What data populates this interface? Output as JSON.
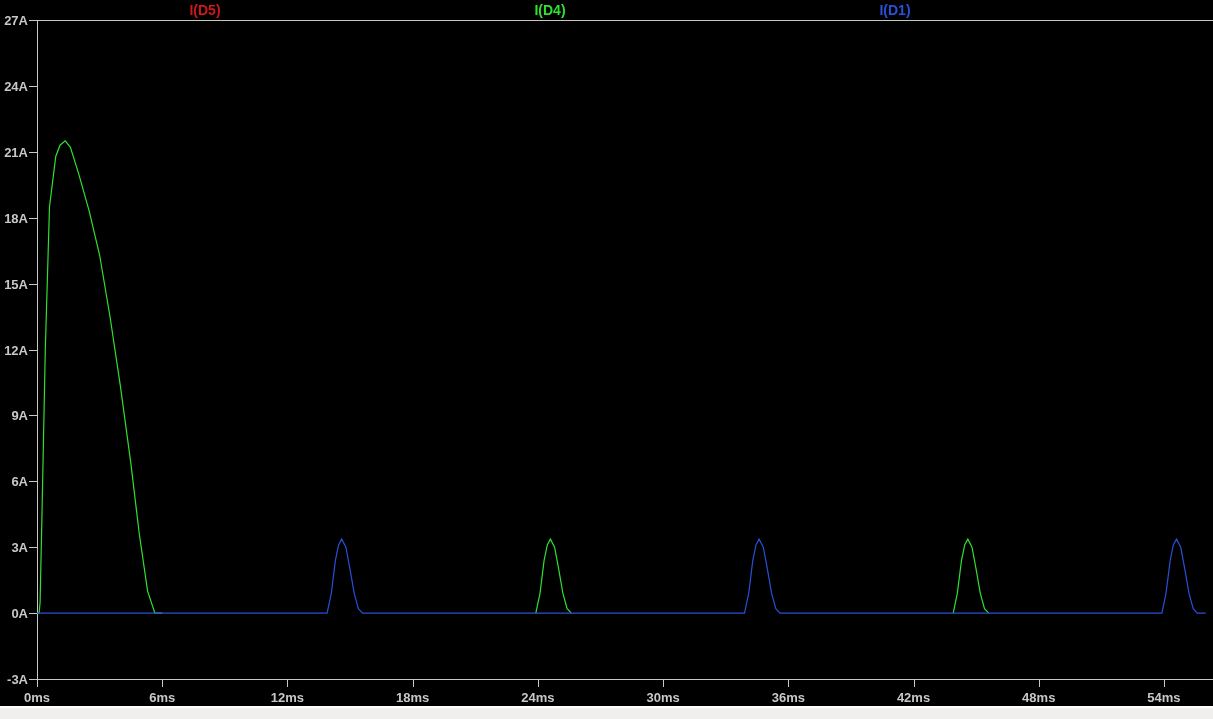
{
  "plot": {
    "chart_data": {
      "type": "line",
      "xlim": [
        0,
        56.35
      ],
      "ylim": [
        -3,
        27
      ],
      "xticks": [
        {
          "value": 0,
          "label": "0ms"
        },
        {
          "value": 6,
          "label": "6ms"
        },
        {
          "value": 12,
          "label": "12ms"
        },
        {
          "value": 18,
          "label": "18ms"
        },
        {
          "value": 24,
          "label": "24ms"
        },
        {
          "value": 30,
          "label": "30ms"
        },
        {
          "value": 36,
          "label": "36ms"
        },
        {
          "value": 42,
          "label": "42ms"
        },
        {
          "value": 48,
          "label": "48ms"
        },
        {
          "value": 54,
          "label": "54ms"
        }
      ],
      "yticks": [
        {
          "value": 27,
          "label": "27A"
        },
        {
          "value": 24,
          "label": "24A"
        },
        {
          "value": 21,
          "label": "21A"
        },
        {
          "value": 18,
          "label": "18A"
        },
        {
          "value": 15,
          "label": "15A"
        },
        {
          "value": 12,
          "label": "12A"
        },
        {
          "value": 9,
          "label": "9A"
        },
        {
          "value": 6,
          "label": "6A"
        },
        {
          "value": 3,
          "label": "3A"
        },
        {
          "value": 0,
          "label": "0A"
        },
        {
          "value": -3,
          "label": "-3A"
        }
      ],
      "x": [
        0,
        0.1,
        0.15,
        0.25,
        0.4,
        0.6,
        0.9,
        1.1,
        1.35,
        1.6,
        2,
        2.5,
        3,
        3.5,
        4,
        4.5,
        4.9,
        5.3,
        5.65,
        6,
        13.9,
        14.1,
        14.3,
        14.45,
        14.6,
        14.8,
        15,
        15.2,
        15.4,
        15.6,
        23.9,
        24.1,
        24.3,
        24.45,
        24.6,
        24.8,
        25,
        25.2,
        25.4,
        25.6,
        33.9,
        34.1,
        34.3,
        34.45,
        34.6,
        34.8,
        35,
        35.2,
        35.4,
        35.6,
        43.9,
        44.1,
        44.3,
        44.45,
        44.6,
        44.8,
        45,
        45.2,
        45.4,
        45.6,
        53.9,
        54.1,
        54.3,
        54.45,
        54.6,
        54.8,
        55,
        55.2,
        55.4,
        55.6,
        56
      ],
      "series": [
        {
          "name": "I(D5)",
          "color": "#d01818",
          "values": [
            null,
            null,
            null,
            null,
            null,
            null,
            null,
            null,
            null,
            null,
            null,
            null,
            null,
            null,
            null,
            null,
            null,
            null,
            null,
            null,
            null,
            null,
            null,
            null,
            null,
            null,
            null,
            null,
            null,
            null,
            null,
            null,
            null,
            null,
            null,
            null,
            null,
            null,
            null,
            null,
            null,
            null,
            null,
            null,
            null,
            null,
            null,
            null,
            null,
            null,
            null,
            null,
            null,
            null,
            null,
            null,
            null,
            null,
            null,
            null,
            null,
            null,
            null,
            null,
            null,
            null,
            null,
            null,
            null,
            null,
            null
          ]
        },
        {
          "name": "I(D4)",
          "color": "#30e030",
          "values": [
            0,
            0,
            0.5,
            5,
            12,
            18.5,
            20.8,
            21.3,
            21.5,
            21.2,
            20,
            18.3,
            16.3,
            13.5,
            10.3,
            6.8,
            3.6,
            1,
            0,
            0,
            null,
            null,
            null,
            null,
            null,
            null,
            null,
            null,
            null,
            null,
            0,
            0.9,
            2.4,
            3.1,
            3.37,
            3,
            2,
            0.9,
            0.2,
            0,
            null,
            null,
            null,
            null,
            null,
            null,
            null,
            null,
            null,
            null,
            0,
            0.9,
            2.4,
            3.1,
            3.37,
            3,
            2,
            0.9,
            0.2,
            0,
            null,
            null,
            null,
            null,
            null,
            null,
            null,
            null,
            null,
            null,
            null
          ]
        },
        {
          "name": "I(D1)",
          "color": "#2850d8",
          "values": [
            0,
            0,
            0,
            0,
            0,
            0,
            0,
            0,
            0,
            0,
            0,
            0,
            0,
            0,
            0,
            0,
            0,
            0,
            0,
            0,
            0,
            0.9,
            2.4,
            3.1,
            3.37,
            3,
            2,
            0.9,
            0.2,
            0,
            0,
            0,
            0,
            0,
            0,
            0,
            0,
            0,
            0,
            0,
            0,
            0.9,
            2.4,
            3.1,
            3.37,
            3,
            2,
            0.9,
            0.2,
            0,
            0,
            0,
            0,
            0,
            0,
            0,
            0,
            0,
            0,
            0,
            0,
            0.9,
            2.4,
            3.1,
            3.37,
            3,
            2,
            0.9,
            0.2,
            0,
            0
          ]
        }
      ]
    }
  }
}
